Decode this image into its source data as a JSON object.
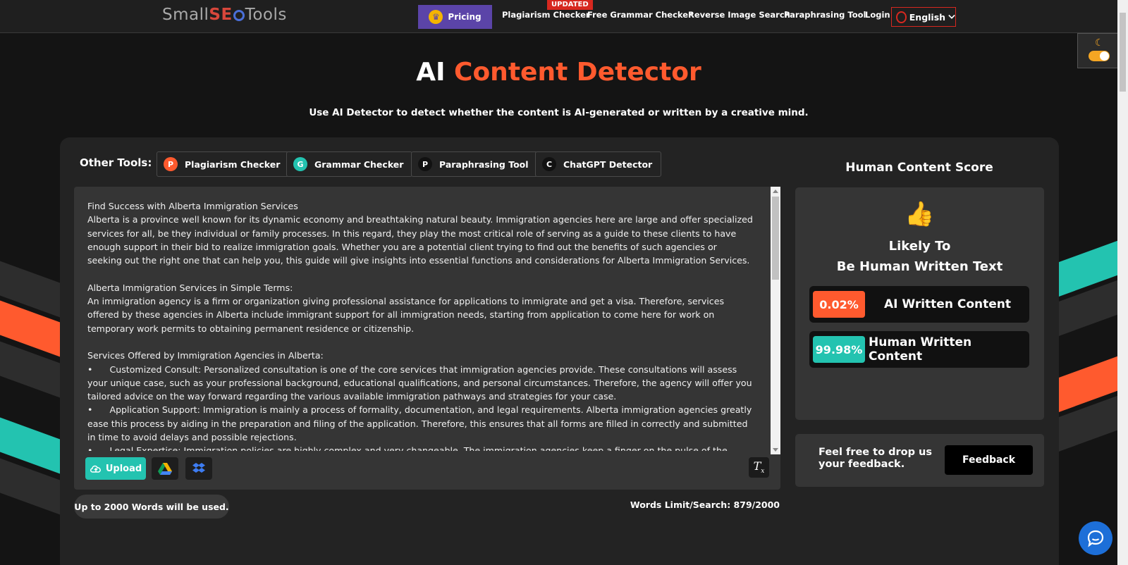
{
  "nav": {
    "logo_prefix": "Small",
    "logo_seo": "SE",
    "logo_suffix": "Tools",
    "pricing": "Pricing",
    "updated_badge": "UPDATED",
    "links": [
      "Plagiarism Checker",
      "Free Grammar Checker",
      "Reverse Image Search",
      "Paraphrasing Tool",
      "Login"
    ],
    "language": "English"
  },
  "hero": {
    "title_plain": "AI",
    "title_accent": "Content Detector",
    "subtitle": "Use AI Detector to detect whether the content is AI-generated or written by a creative mind."
  },
  "other_tools": {
    "label": "Other Tools:",
    "items": [
      {
        "icon_letter": "P",
        "label": "Plagiarism Checker",
        "color": "#ff5a2e"
      },
      {
        "icon_letter": "G",
        "label": "Grammar Checker",
        "color": "#23c3b0"
      },
      {
        "icon_letter": "P",
        "label": "Paraphrasing Tool",
        "color": "#111111"
      },
      {
        "icon_letter": "C",
        "label": "ChatGPT Detector",
        "color": "#111111"
      }
    ]
  },
  "editor": {
    "text": "Find Success with Alberta Immigration Services\nAlberta is a province well known for its dynamic economy and breathtaking natural beauty. Immigration agencies here are large and offer specialized services for all, be they individual or family processes. In this regard, they play the most critical role of serving as a guide to these clients to have enough support in their bid to realize immigration goals. Whether you are a potential client trying to find out the benefits of such agencies or seeking out the right one that can help you, this guide will give insights into essential functions and considerations for Alberta Immigration Services.\n\nAlberta Immigration Services in Simple Terms:\nAn immigration agency is a firm or organization giving professional assistance for applications to immigrate and get a visa. Therefore, services offered by these agencies in Alberta include immigrant support for all immigration needs, starting from application to come here for work on temporary work permits to obtaining permanent residence or citizenship.\n\nServices Offered by Immigration Agencies in Alberta:\n•      Customized Consult: Personalized consultation is one of the core services that immigration agencies provide. These consultations will assess your unique case, such as your professional background, educational qualifications, and personal circumstances. Therefore, the agency will offer you tailored advice on the way forward regarding the various available immigration pathways and strategies for your case.\n•      Application Support: Immigration is mainly a process of formality, documentation, and legal requirements. Alberta immigration agencies greatly ease this process by aiding in the preparation and filing of the application. Therefore, this ensures that all forms are filled in correctly and submitted in time to avoid delays and possible rejections.\n•      Legal Expertise: Immigration policies are highly complex and very changeable. The immigration agencies keep a finger on the pulse of the current",
    "upload_label": "Upload",
    "limit_note": "Up to 2000 Words will be used.",
    "words_count": "Words Limit/Search: 879/2000"
  },
  "score": {
    "title": "Human Content Score",
    "verdict_line1": "Likely To",
    "verdict_line2": "Be Human Written Text",
    "ai_pct": "0.02%",
    "ai_label": "AI Written Content",
    "ai_color": "#ff5a2e",
    "human_pct": "99.98%",
    "human_label": "Human Written Content",
    "human_color": "#23c3b0"
  },
  "feedback": {
    "text": "Feel free to drop us your feedback.",
    "button": "Feedback"
  }
}
